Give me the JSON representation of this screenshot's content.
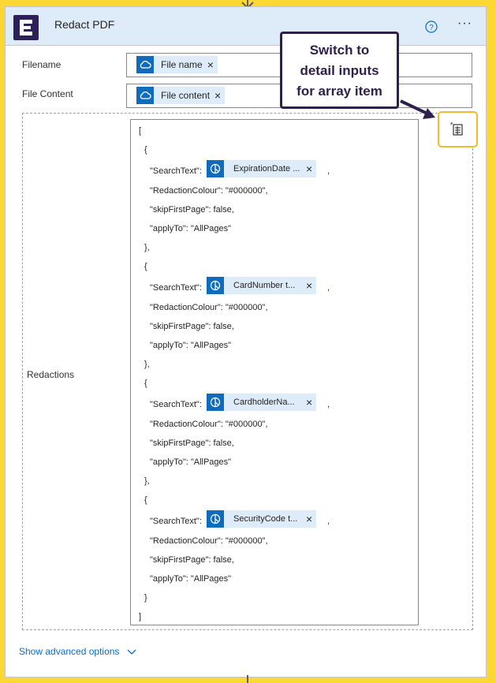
{
  "action": {
    "title": "Redact PDF",
    "help_icon": "help-circle-icon",
    "more_icon": "more-horizontal-icon"
  },
  "fields": {
    "filename": {
      "label": "Filename",
      "token": "File name",
      "token_icon": "onedrive-cloud-icon"
    },
    "file_content": {
      "label": "File Content",
      "token": "File content",
      "token_icon": "onedrive-cloud-icon"
    },
    "redactions": {
      "label": "Redactions",
      "open_bracket": "[",
      "close_bracket": "]",
      "items": [
        {
          "open": "{",
          "search_key": "\"SearchText\":",
          "token": "ExpirationDate ...",
          "comma": ",",
          "colour": "\"RedactionColour\": \"#000000\",",
          "skip": "\"skipFirstPage\": false,",
          "apply": "\"applyTo\": \"AllPages\"",
          "close": "},"
        },
        {
          "open": "{",
          "search_key": "\"SearchText\":",
          "token": "CardNumber t...",
          "comma": ",",
          "colour": "\"RedactionColour\": \"#000000\",",
          "skip": "\"skipFirstPage\": false,",
          "apply": "\"applyTo\": \"AllPages\"",
          "close": "},"
        },
        {
          "open": "{",
          "search_key": "\"SearchText\":",
          "token": "CardholderNa...",
          "comma": ",",
          "colour": "\"RedactionColour\": \"#000000\",",
          "skip": "\"skipFirstPage\": false,",
          "apply": "\"applyTo\": \"AllPages\"",
          "close": "},"
        },
        {
          "open": "{",
          "search_key": "\"SearchText\":",
          "token": "SecurityCode t...",
          "comma": ",",
          "colour": "\"RedactionColour\": \"#000000\",",
          "skip": "\"skipFirstPage\": false,",
          "apply": "\"applyTo\": \"AllPages\"",
          "close": "}"
        }
      ]
    }
  },
  "switch_button_icon": "switch-to-detail-inputs-icon",
  "callout": {
    "line1": "Switch to",
    "line2": "detail inputs",
    "line3": "for array item"
  },
  "advanced_label": "Show advanced options",
  "colors": {
    "accent": "#0f6cbd",
    "header_bg": "#deecf9",
    "highlight": "#f5b82e",
    "callout": "#2e1f4b",
    "background": "#fdd835"
  }
}
